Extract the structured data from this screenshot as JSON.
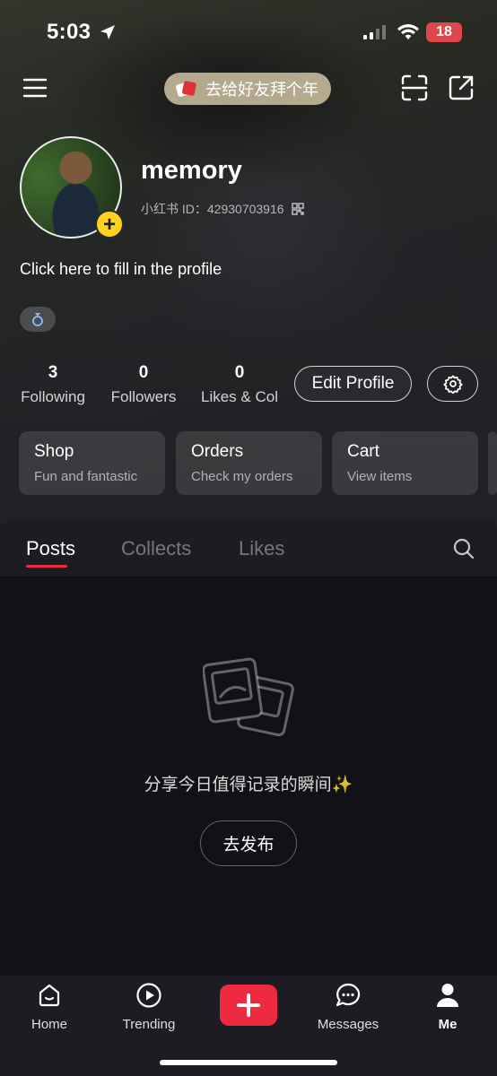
{
  "status_bar": {
    "time": "5:03",
    "battery": "18"
  },
  "header": {
    "greeting_pill": "去给好友拜个年"
  },
  "profile": {
    "username": "memory",
    "id_label": "小红书 ID：",
    "id_value": "42930703916",
    "bio": "Click here to fill in the profile",
    "tag_icon": "ring-icon"
  },
  "stats": [
    {
      "value": "3",
      "label": "Following"
    },
    {
      "value": "0",
      "label": "Followers"
    },
    {
      "value": "0",
      "label": "Likes & Col"
    }
  ],
  "actions": {
    "edit_profile": "Edit Profile"
  },
  "cards": [
    {
      "title": "Shop",
      "subtitle": "Fun and fantastic"
    },
    {
      "title": "Orders",
      "subtitle": "Check my orders"
    },
    {
      "title": "Cart",
      "subtitle": "View items"
    }
  ],
  "tabs": [
    {
      "label": "Posts",
      "active": true
    },
    {
      "label": "Collects",
      "active": false
    },
    {
      "label": "Likes",
      "active": false
    }
  ],
  "empty_state": {
    "message": "分享今日值得记录的瞬间✨",
    "button": "去发布"
  },
  "nav": [
    {
      "label": "Home",
      "icon": "home-icon"
    },
    {
      "label": "Trending",
      "icon": "play-icon"
    },
    {
      "label": "Messages",
      "icon": "chat-icon"
    },
    {
      "label": "Me",
      "icon": "user-icon"
    }
  ],
  "colors": {
    "accent": "#ee2a40",
    "badge": "#ffd21f",
    "battery": "#e0474c"
  }
}
